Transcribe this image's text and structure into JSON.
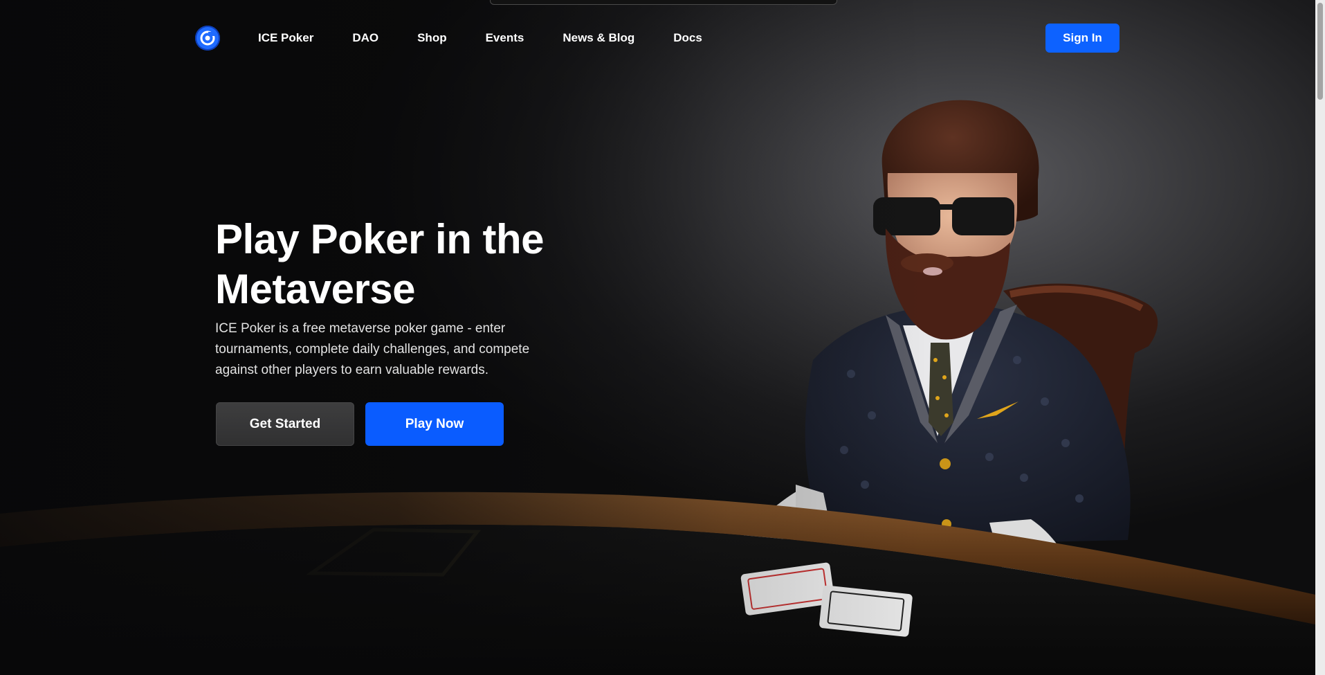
{
  "nav": {
    "logo_icon": "ice-poker-logo-icon",
    "links": [
      {
        "label": "ICE Poker"
      },
      {
        "label": "DAO"
      },
      {
        "label": "Shop"
      },
      {
        "label": "Events"
      },
      {
        "label": "News & Blog"
      },
      {
        "label": "Docs"
      }
    ],
    "sign_in_label": "Sign In"
  },
  "hero": {
    "title": "Play Poker in the Metaverse",
    "description": "ICE Poker is a free metaverse poker game - enter tournaments, complete daily challenges, and compete against other players to earn valuable rewards.",
    "primary_button": "Get Started",
    "secondary_button": "Play Now",
    "illustration": "bearded-poker-player-avatar"
  },
  "colors": {
    "accent": "#0d62ff",
    "background": "#0d0d0e",
    "button_dark": "#353536",
    "gold": "#e0a51b"
  }
}
